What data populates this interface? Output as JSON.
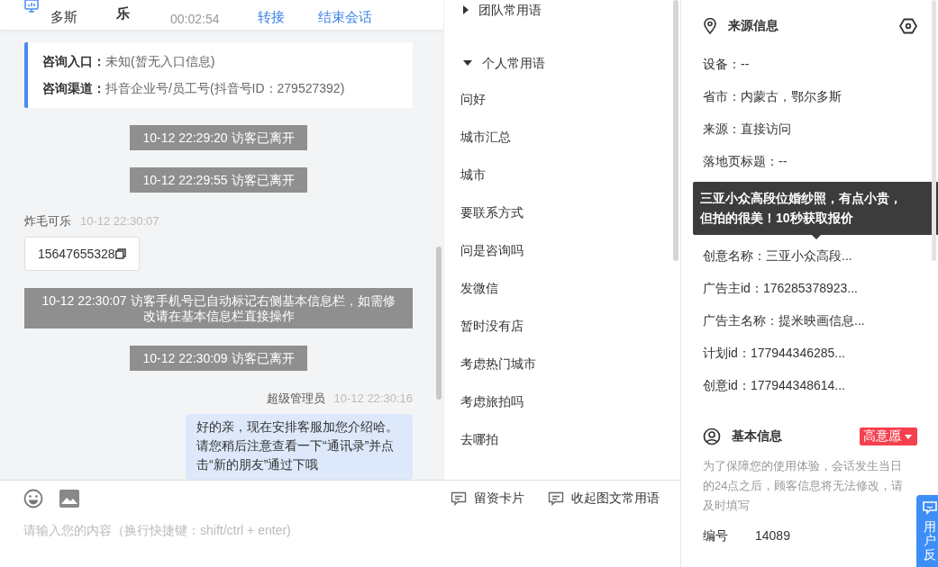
{
  "header": {
    "location": "多斯",
    "visitor": "乐",
    "duration": "00:02:54",
    "actions": [
      {
        "label": "转接"
      },
      {
        "label": "结束会话"
      }
    ]
  },
  "info_card": [
    "**咨询入口：**未知(暂无入口信息)",
    "**咨询渠道：**抖音企业号/员工号(抖音号ID：279527392)"
  ],
  "messages": [
    {
      "kind": "notice",
      "text": "10-12 22:29:20 访客已离开"
    },
    {
      "kind": "notice",
      "text": "10-12 22:29:55 访客已离开"
    },
    {
      "kind": "visitor",
      "name": "炸毛可乐",
      "time": "10-12 22:30:07",
      "text": "15647655328"
    },
    {
      "kind": "notice",
      "text": "10-12 22:30:07 访客手机号已自动标记右侧基本信息栏，如需修改请在基本信息栏直接操作"
    },
    {
      "kind": "notice",
      "text": "10-12 22:30:09 访客已离开"
    },
    {
      "kind": "agent",
      "name": "超级管理员",
      "time": "10-12 22:30:16",
      "text": "好的亲，现在安排客服加您介绍哈。请您稍后注意查看一下“通讯录”并点击“新的朋友”通过下哦"
    }
  ],
  "phrases": [
    {
      "label": "团队常用语",
      "expanded": false
    },
    {
      "label": "个人常用语",
      "expanded": true,
      "children": [
        "问好",
        "城市汇总",
        "城市",
        "要联系方式",
        "问是咨询吗",
        "发微信",
        "暂时没有店",
        "考虑热门城市",
        "考虑旅拍吗",
        "去哪拍"
      ]
    }
  ],
  "composer": {
    "tools": [
      {
        "label": "留资卡片"
      },
      {
        "label": "收起图文常用语"
      }
    ],
    "placeholder": "请输入您的内容（换行快捷键：shift/ctrl + enter)"
  },
  "source": {
    "title": "来源信息",
    "rows": [
      {
        "kind": "field",
        "text": "设备：--"
      },
      {
        "kind": "field",
        "text": "省市：内蒙古，鄂尔多斯"
      },
      {
        "kind": "field",
        "text": "来源：直接访问"
      },
      {
        "kind": "field",
        "text": "落地页标题：--"
      },
      {
        "kind": "tooltip",
        "text": "三亚小众高段位婚纱照，有点小贵，但拍的很美！10秒获取报价"
      },
      {
        "kind": "field",
        "text": "创意名称：三亚小众高段..."
      },
      {
        "kind": "field",
        "text": "广告主id：176285378923..."
      },
      {
        "kind": "field",
        "text": "广告主名称：提米映画信息..."
      },
      {
        "kind": "field",
        "text": "计划id：177944346285..."
      },
      {
        "kind": "field",
        "text": "创意id：177944348614..."
      }
    ]
  },
  "basic": {
    "title": "基本信息",
    "tag": "高意愿",
    "note": "为了保障您的使用体验，会话发生当日的24点之后，顾客信息将无法修改，请及时填写",
    "fields": [
      {
        "label": "编号",
        "value": "14089"
      }
    ]
  },
  "feedback": {
    "label": "用户反"
  }
}
